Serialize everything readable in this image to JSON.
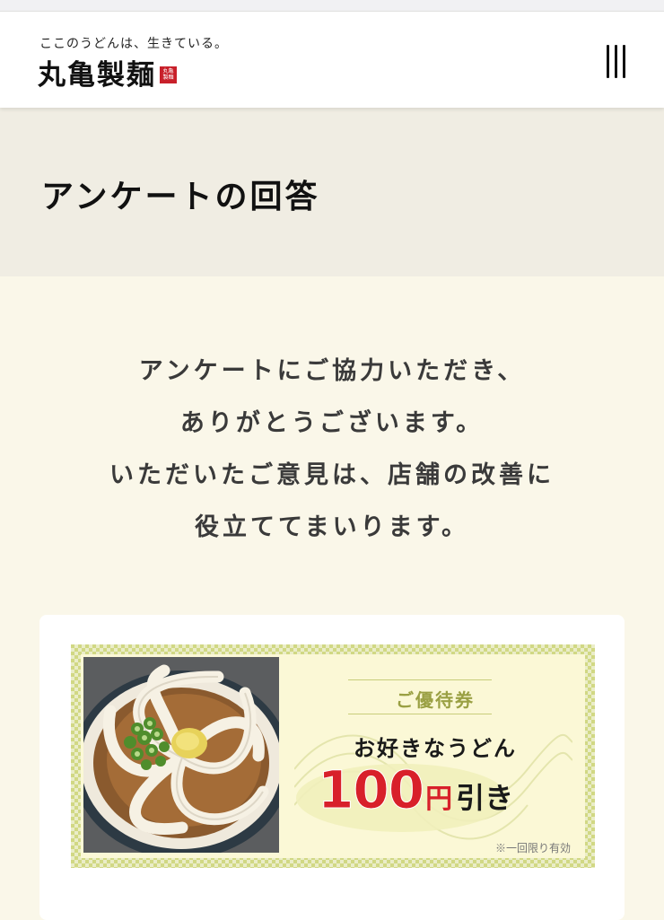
{
  "header": {
    "tagline": "ここのうどんは、生きている。",
    "logo": "丸亀製麺",
    "logo_seal": "丸亀製麺",
    "menu_icon": "hamburger-menu-icon"
  },
  "page": {
    "title": "アンケートの回答"
  },
  "message": {
    "lines": [
      "アンケートにご協力いただき、",
      "ありがとうございます。",
      "いただいたご意見は、店舗の改善に",
      "役立ててまいります。"
    ]
  },
  "coupon": {
    "label": "ご優待券",
    "item": "お好きなうどん",
    "amount": "100",
    "yen": "円",
    "discount": "引き",
    "note": "※一回限り有効"
  },
  "colors": {
    "background": "#faf7e9",
    "title_band": "#f0ede3",
    "coupon_border": "#d1d884",
    "price_red": "#d8202a"
  }
}
